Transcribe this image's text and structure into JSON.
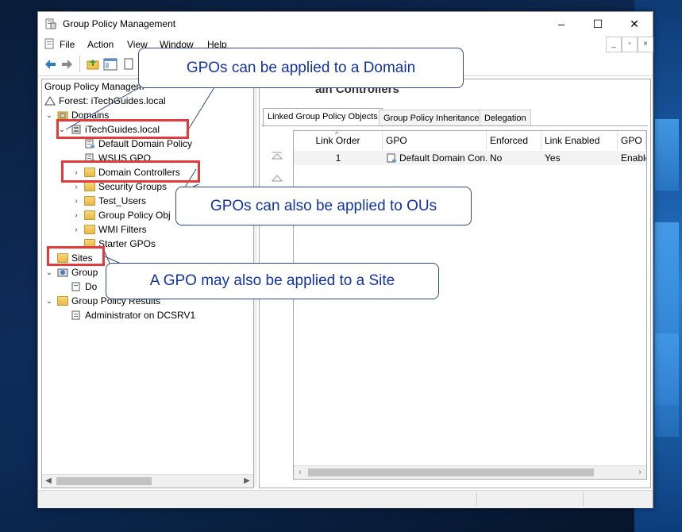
{
  "window": {
    "title": "Group Policy Management",
    "caption_buttons": [
      "–",
      "☐",
      "✕"
    ]
  },
  "menu": [
    "File",
    "Action",
    "View",
    "Window",
    "Help"
  ],
  "mdi_buttons": [
    "_",
    "▫",
    "×"
  ],
  "tree": {
    "root": "Group Policy Managem",
    "forest": "Forest: iTechGuides.local",
    "domains": "Domains",
    "domain": "iTechGuides.local",
    "children": [
      "Default Domain Policy",
      "WSUS GPO",
      "Domain Controllers",
      "Security Groups",
      "Test_Users",
      "Group Policy Obj",
      "WMI Filters",
      "Starter GPOs"
    ],
    "sites": "Sites",
    "modeling": "Group",
    "modeling_child": "Do",
    "results": "Group Policy Results",
    "results_child": "Administrator on DCSRV1"
  },
  "right": {
    "header": "ain Controllers",
    "tabs": [
      "Linked Group Policy Objects",
      "Group Policy Inheritance",
      "Delegation"
    ],
    "columns": [
      "Link Order",
      "GPO",
      "Enforced",
      "Link Enabled",
      "GPO S"
    ],
    "rows": [
      {
        "order": "1",
        "gpo": "Default Domain Con...",
        "enforced": "No",
        "enabled": "Yes",
        "status": "Enable"
      }
    ]
  },
  "callouts": {
    "domain": "GPOs can be applied to a Domain",
    "ou": "GPOs can also be applied to OUs",
    "site": "A GPO may also be applied to a Site"
  },
  "colors": {
    "callout_text": "#1133a6",
    "highlight": "#e23b3b",
    "desktop": "#0e2c5a"
  }
}
